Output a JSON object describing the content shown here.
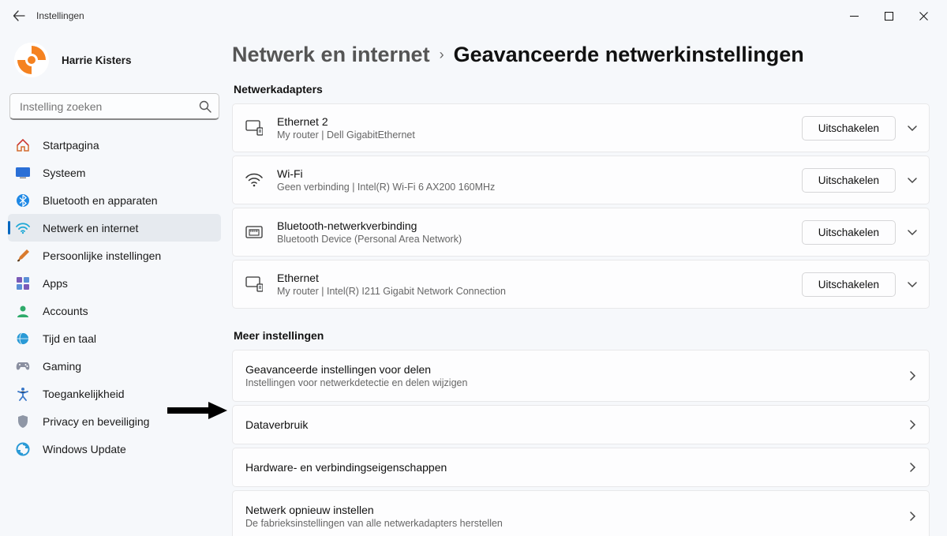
{
  "window": {
    "title": "Instellingen"
  },
  "user": {
    "name": "Harrie Kisters"
  },
  "search": {
    "placeholder": "Instelling zoeken"
  },
  "sidebar": {
    "items": [
      {
        "label": "Startpagina"
      },
      {
        "label": "Systeem"
      },
      {
        "label": "Bluetooth en apparaten"
      },
      {
        "label": "Netwerk en internet"
      },
      {
        "label": "Persoonlijke instellingen"
      },
      {
        "label": "Apps"
      },
      {
        "label": "Accounts"
      },
      {
        "label": "Tijd en taal"
      },
      {
        "label": "Gaming"
      },
      {
        "label": "Toegankelijkheid"
      },
      {
        "label": "Privacy en beveiliging"
      },
      {
        "label": "Windows Update"
      }
    ]
  },
  "breadcrumb": {
    "parent": "Netwerk en internet",
    "current": "Geavanceerde netwerkinstellingen"
  },
  "sections": {
    "adapters_heading": "Netwerkadapters",
    "more_heading": "Meer instellingen",
    "disable_label": "Uitschakelen"
  },
  "adapters": [
    {
      "title": "Ethernet 2",
      "sub": "My router | Dell GigabitEthernet"
    },
    {
      "title": "Wi-Fi",
      "sub": "Geen verbinding | Intel(R) Wi-Fi 6 AX200 160MHz"
    },
    {
      "title": "Bluetooth-netwerkverbinding",
      "sub": "Bluetooth Device (Personal Area Network)"
    },
    {
      "title": "Ethernet",
      "sub": "My router | Intel(R) I211 Gigabit Network Connection"
    }
  ],
  "more": [
    {
      "title": "Geavanceerde instellingen voor delen",
      "sub": "Instellingen voor netwerkdetectie en delen wijzigen"
    },
    {
      "title": "Dataverbruik",
      "sub": ""
    },
    {
      "title": "Hardware- en verbindingseigenschappen",
      "sub": ""
    },
    {
      "title": "Netwerk opnieuw instellen",
      "sub": "De fabrieksinstellingen van alle netwerkadapters herstellen"
    }
  ]
}
